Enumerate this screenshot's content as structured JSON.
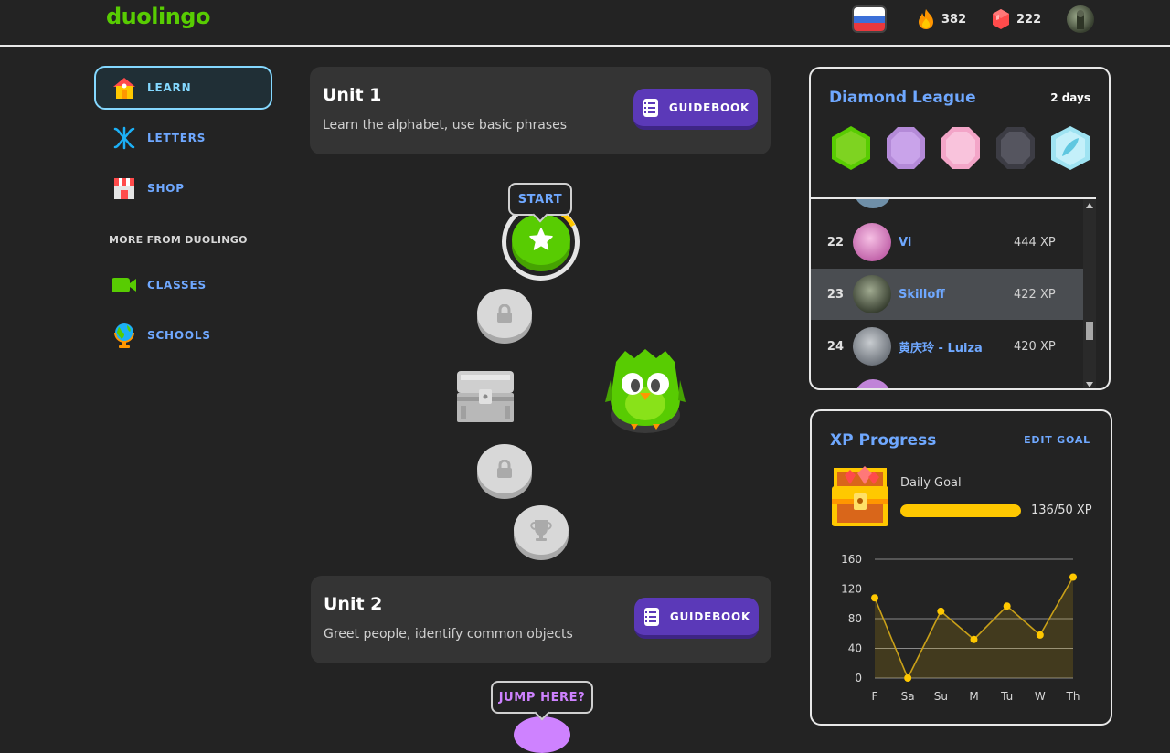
{
  "header": {
    "logo": "duolingo",
    "streak": "382",
    "gems": "222"
  },
  "sidebar": {
    "items": [
      {
        "label": "LEARN",
        "icon": "home-icon"
      },
      {
        "label": "LETTERS",
        "icon": "cyrillic-letter-icon"
      },
      {
        "label": "SHOP",
        "icon": "shop-icon"
      }
    ],
    "more_title": "MORE FROM DUOLINGO",
    "more_items": [
      {
        "label": "CLASSES",
        "icon": "camera-icon"
      },
      {
        "label": "SCHOOLS",
        "icon": "globe-icon"
      }
    ]
  },
  "path": {
    "units": [
      {
        "title": "Unit 1",
        "description": "Learn the alphabet, use basic phrases",
        "button": "GUIDEBOOK"
      },
      {
        "title": "Unit 2",
        "description": "Greet people, identify common objects",
        "button": "GUIDEBOOK"
      }
    ],
    "start_label": "START",
    "jump_label": "JUMP HERE?"
  },
  "league": {
    "title": "Diamond League",
    "days": "2 days",
    "rows": [
      {
        "rank": "22",
        "name": "Vi",
        "xp": "444 XP"
      },
      {
        "rank": "23",
        "name": "Skilloff",
        "xp": "422 XP"
      },
      {
        "rank": "24",
        "name": "黄庆玲 - Luiza",
        "xp": "420 XP"
      }
    ]
  },
  "xp_progress": {
    "title": "XP Progress",
    "edit_goal": "EDIT GOAL",
    "daily_goal_label": "Daily Goal",
    "daily_goal_value": "136/50 XP",
    "daily_goal_fraction": 1.0
  },
  "colors": {
    "accent_blue": "#6fa8ff",
    "green": "#58cc02",
    "guidebook_purple": "#5b39b8",
    "gold": "#ffc800"
  },
  "chart_data": {
    "type": "line",
    "categories": [
      "F",
      "Sa",
      "Su",
      "M",
      "Tu",
      "W",
      "Th"
    ],
    "values": [
      108,
      0,
      90,
      52,
      97,
      58,
      136
    ],
    "ylim": [
      0,
      160
    ],
    "yticks": [
      "160",
      "120",
      "80",
      "40",
      "0"
    ],
    "grid": true
  }
}
